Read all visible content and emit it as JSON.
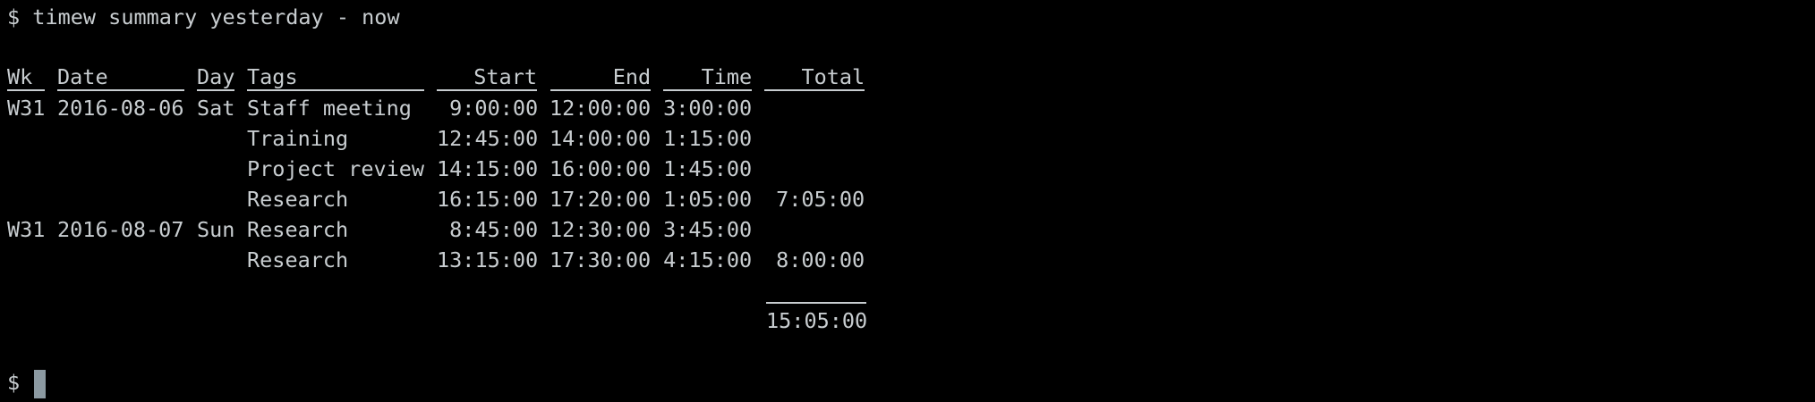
{
  "terminal": {
    "command_line": "$ timew summary yesterday - now",
    "prompt": "$ "
  },
  "columns": {
    "wk": "Wk",
    "date": "Date",
    "day": "Day",
    "tags": "Tags",
    "start": "Start",
    "end": "End",
    "time": "Time",
    "total": "Total"
  },
  "rows": [
    {
      "wk": "W31",
      "date": "2016-08-06",
      "day": "Sat",
      "tags": "Staff meeting",
      "start": "9:00:00",
      "end": "12:00:00",
      "time": "3:00:00",
      "total": ""
    },
    {
      "wk": "",
      "date": "",
      "day": "",
      "tags": "Training",
      "start": "12:45:00",
      "end": "14:00:00",
      "time": "1:15:00",
      "total": ""
    },
    {
      "wk": "",
      "date": "",
      "day": "",
      "tags": "Project review",
      "start": "14:15:00",
      "end": "16:00:00",
      "time": "1:45:00",
      "total": ""
    },
    {
      "wk": "",
      "date": "",
      "day": "",
      "tags": "Research",
      "start": "16:15:00",
      "end": "17:20:00",
      "time": "1:05:00",
      "total": "7:05:00"
    },
    {
      "wk": "W31",
      "date": "2016-08-07",
      "day": "Sun",
      "tags": "Research",
      "start": "8:45:00",
      "end": "12:30:00",
      "time": "3:45:00",
      "total": ""
    },
    {
      "wk": "",
      "date": "",
      "day": "",
      "tags": "Research",
      "start": "13:15:00",
      "end": "17:30:00",
      "time": "4:15:00",
      "total": "8:00:00"
    }
  ],
  "grand_total": "15:05:00",
  "colors": {
    "background": "#000000",
    "text": "#c8cdd0",
    "cursor": "#8c9aa2"
  }
}
